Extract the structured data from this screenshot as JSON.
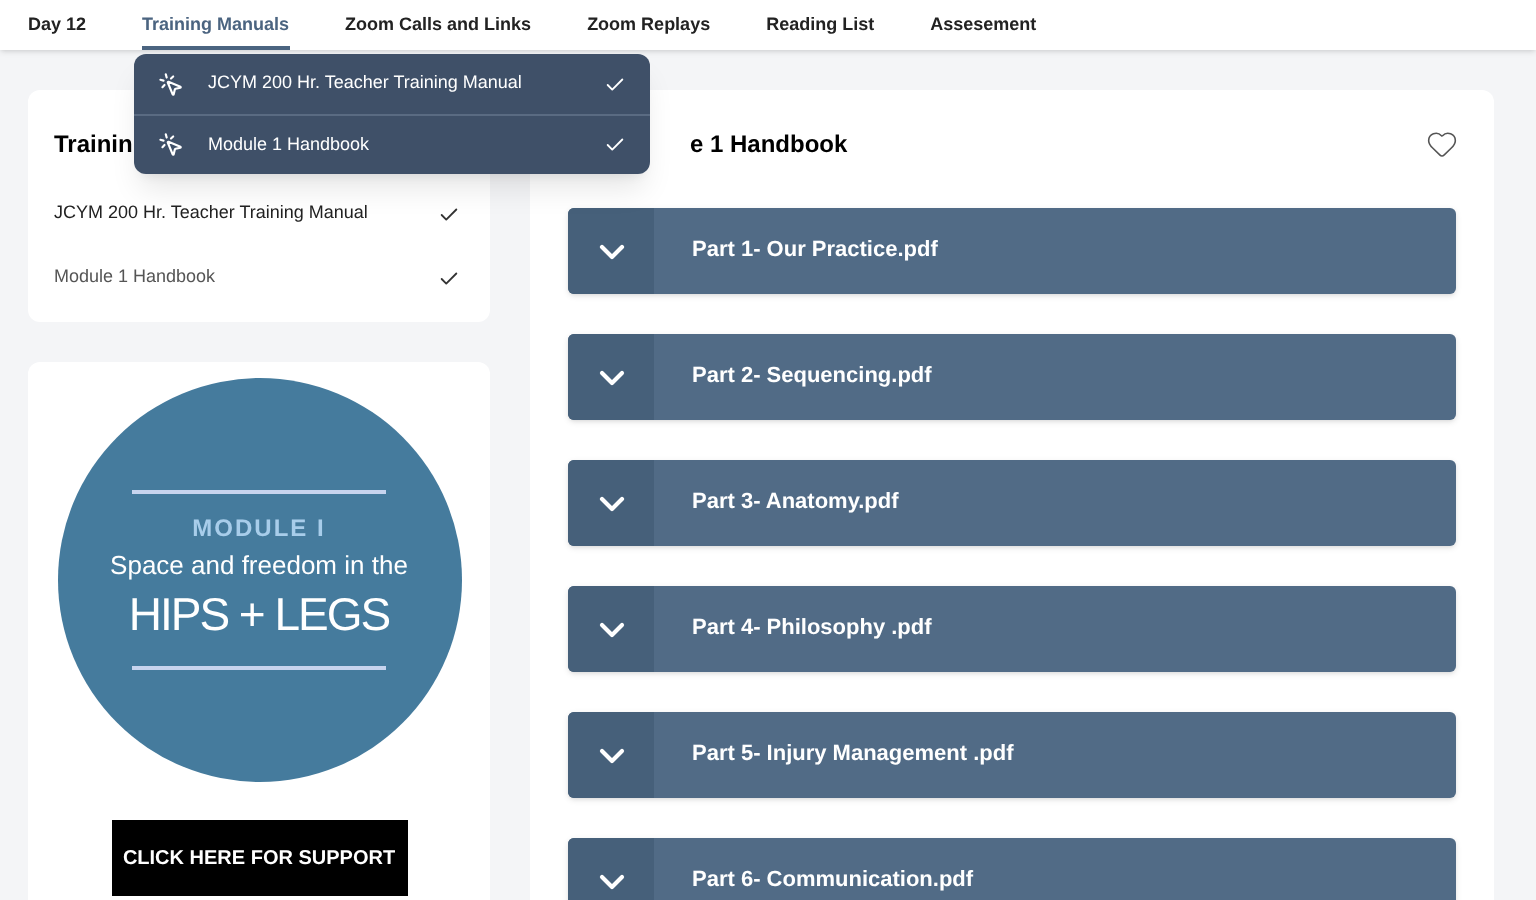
{
  "nav": [
    {
      "label": "Day 12",
      "selected": false
    },
    {
      "label": "Training Manuals",
      "selected": true
    },
    {
      "label": "Zoom Calls and Links",
      "selected": false
    },
    {
      "label": "Zoom Replays",
      "selected": false
    },
    {
      "label": "Reading List",
      "selected": false
    },
    {
      "label": "Assesement",
      "selected": false
    }
  ],
  "menu": [
    {
      "label": "JCYM 200 Hr. Teacher Training Manual",
      "checked": true
    },
    {
      "label": "Module 1 Handbook",
      "checked": true
    }
  ],
  "sidebar": {
    "title": "Trainin",
    "items": [
      {
        "label": "JCYM 200 Hr. Teacher Training Manual",
        "checked": true
      },
      {
        "label": "Module 1 Handbook",
        "checked": true
      }
    ]
  },
  "module_card": {
    "overline": "MODULE I",
    "subtitle": "Space and freedom in the",
    "headline": "HIPS + LEGS",
    "button": "CLICK HERE FOR SUPPORT"
  },
  "main": {
    "title": "e 1 Handbook",
    "favorite": false,
    "files": [
      {
        "name": "Part 1- Our Practice.pdf",
        "expanded": false
      },
      {
        "name": "Part 2- Sequencing.pdf",
        "expanded": false
      },
      {
        "name": "Part 3- Anatomy.pdf",
        "expanded": false
      },
      {
        "name": "Part 4- Philosophy .pdf",
        "expanded": false
      },
      {
        "name": "Part 5- Injury Management .pdf",
        "expanded": false
      },
      {
        "name": "Part 6- Communication.pdf",
        "expanded": false
      }
    ]
  }
}
